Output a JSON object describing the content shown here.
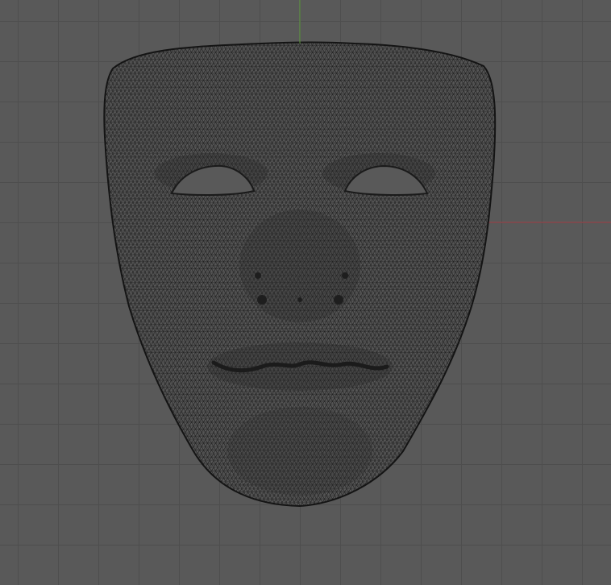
{
  "viewport": {
    "view": "3d-viewport-wireframe",
    "background_color": "#595959",
    "grid_color": "#4e4e4e",
    "axis_x_color": "#a8434a",
    "axis_y_color": "#5e9a40",
    "mesh_wire_color": "#1a1a1a",
    "object": {
      "name_icon": "mask-mesh-icon",
      "display": "wireframe"
    }
  }
}
